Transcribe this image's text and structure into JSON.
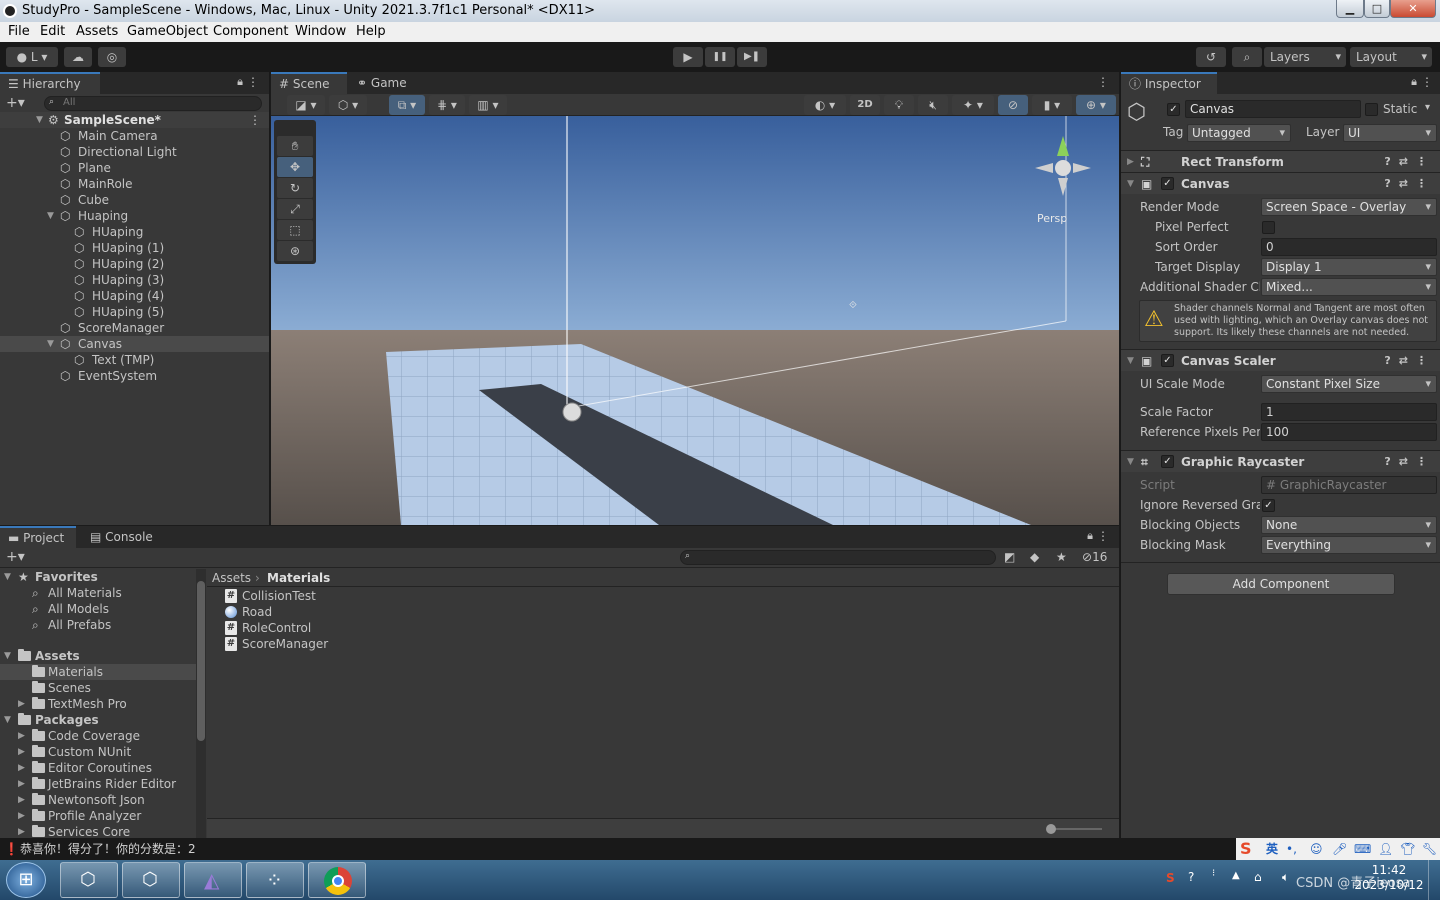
{
  "window": {
    "title": "StudyPro - SampleScene - Windows, Mac, Linux - Unity 2021.3.7f1c1 Personal* <DX11>",
    "buttons": {
      "minimize": "▁",
      "maximize": "□",
      "close": "✕"
    }
  },
  "menu": [
    "File",
    "Edit",
    "Assets",
    "GameObject",
    "Component",
    "Window",
    "Help"
  ],
  "toolbar": {
    "account_label": "L",
    "layers_label": "Layers",
    "layout_label": "Layout",
    "play": "▶",
    "pause": "❚❚",
    "step": "▶❚"
  },
  "hierarchy": {
    "tab": "Hierarchy",
    "search_placeholder": "All",
    "scene_name": "SampleScene*",
    "items": [
      {
        "label": "Main Camera",
        "depth": 1
      },
      {
        "label": "Directional Light",
        "depth": 1
      },
      {
        "label": "Plane",
        "depth": 1
      },
      {
        "label": "MainRole",
        "depth": 1
      },
      {
        "label": "Cube",
        "depth": 1
      },
      {
        "label": "Huaping",
        "depth": 1,
        "expanded": true
      },
      {
        "label": "HUaping",
        "depth": 2
      },
      {
        "label": "HUaping (1)",
        "depth": 2
      },
      {
        "label": "HUaping (2)",
        "depth": 2
      },
      {
        "label": "HUaping (3)",
        "depth": 2
      },
      {
        "label": "HUaping (4)",
        "depth": 2
      },
      {
        "label": "HUaping (5)",
        "depth": 2
      },
      {
        "label": "ScoreManager",
        "depth": 1
      },
      {
        "label": "Canvas",
        "depth": 1,
        "expanded": true,
        "selected": true
      },
      {
        "label": "Text (TMP)",
        "depth": 2
      },
      {
        "label": "EventSystem",
        "depth": 1
      }
    ]
  },
  "scene": {
    "tabs": [
      "Scene",
      "Game"
    ],
    "active_tab": "Scene",
    "mode_2d": "2D",
    "persp_label": "Persp"
  },
  "inspector": {
    "tab": "Inspector",
    "object_name": "Canvas",
    "static_label": "Static",
    "tag_label": "Tag",
    "tag_value": "Untagged",
    "layer_label": "Layer",
    "layer_value": "UI",
    "rect_transform": "Rect Transform",
    "canvas": {
      "title": "Canvas",
      "render_mode_label": "Render Mode",
      "render_mode": "Screen Space - Overlay",
      "pixel_perfect_label": "Pixel Perfect",
      "sort_order_label": "Sort Order",
      "sort_order": "0",
      "target_display_label": "Target Display",
      "target_display": "Display 1",
      "shader_ch_label": "Additional Shader Ch",
      "shader_ch": "Mixed...",
      "warning": "Shader channels Normal and Tangent are most often used with lighting, which an Overlay canvas does not support. Its likely these channels are not needed."
    },
    "canvas_scaler": {
      "title": "Canvas Scaler",
      "scale_mode_label": "UI Scale Mode",
      "scale_mode": "Constant Pixel Size",
      "scale_factor_label": "Scale Factor",
      "scale_factor": "1",
      "ref_pixels_label": "Reference Pixels Per",
      "ref_pixels": "100"
    },
    "raycaster": {
      "title": "Graphic Raycaster",
      "script_label": "Script",
      "script": "GraphicRaycaster",
      "ignore_label": "Ignore Reversed Grap",
      "blocking_objects_label": "Blocking Objects",
      "blocking_objects": "None",
      "blocking_mask_label": "Blocking Mask",
      "blocking_mask": "Everything"
    },
    "add_component": "Add Component"
  },
  "project": {
    "tabs": [
      "Project",
      "Console"
    ],
    "hidden_count": "16",
    "favorites_label": "Favorites",
    "favorites": [
      "All Materials",
      "All Models",
      "All Prefabs"
    ],
    "assets_label": "Assets",
    "asset_folders": [
      "Materials",
      "Scenes",
      "TextMesh Pro"
    ],
    "packages_label": "Packages",
    "packages": [
      "Code Coverage",
      "Custom NUnit",
      "Editor Coroutines",
      "JetBrains Rider Editor",
      "Newtonsoft Json",
      "Profile Analyzer",
      "Services Core"
    ],
    "breadcrumb": [
      "Assets",
      "Materials"
    ],
    "files": [
      {
        "name": "CollisionTest",
        "icon": "script-icon"
      },
      {
        "name": "Road",
        "icon": "material-icon"
      },
      {
        "name": "RoleControl",
        "icon": "script-icon"
      },
      {
        "name": "ScoreManager",
        "icon": "script-icon"
      }
    ]
  },
  "status": {
    "message": "恭喜你！得分了！你的分数是：2"
  },
  "taskbar": {
    "time": "11:42",
    "date": "2023/10/12",
    "ime_label": "英",
    "watermark": "CSDN @青子ieosa"
  }
}
